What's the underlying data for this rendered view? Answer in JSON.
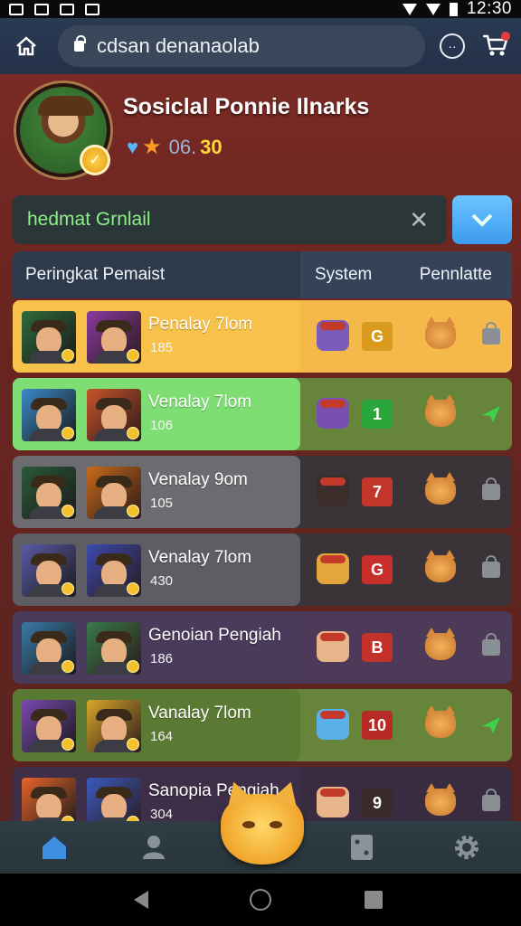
{
  "status_bar": {
    "time": "12:30"
  },
  "browser": {
    "url": "cdsan denanaolab"
  },
  "profile": {
    "name": "Sosiclal Ponnie Ilnarks",
    "stat_a": "06.",
    "stat_b": "30"
  },
  "search": {
    "value": "hedmat Grnlail"
  },
  "table": {
    "header_left": "Peringkat Pemaist",
    "header_col1": "System",
    "header_col2": "Pennlatte",
    "rows": [
      {
        "name": "Penalay 7lom",
        "score": "185",
        "rank": "G",
        "state": "lock",
        "row_bg": "#f5b84a",
        "left_bg": "#f8c24a",
        "rank_bg": "#d99a1e",
        "sys_color": "#7a5cba"
      },
      {
        "name": "Venalay 7lom",
        "score": "106",
        "rank": "1",
        "state": "check",
        "row_bg": "#66853b",
        "left_bg": "#7ede74",
        "rank_bg": "#2aa63a",
        "sys_color": "#7a4fb0"
      },
      {
        "name": "Venalay 9om",
        "score": "105",
        "rank": "7",
        "state": "lock",
        "row_bg": "#3a3438",
        "left_bg": "#6c6c70",
        "rank_bg": "#c4352b",
        "sys_color": "#3a2d2a"
      },
      {
        "name": "Venalay 7lom",
        "score": "430",
        "rank": "G",
        "state": "lock",
        "row_bg": "#3a3438",
        "left_bg": "#5f5d64",
        "rank_bg": "#c82e2a",
        "sys_color": "#e2a63a"
      },
      {
        "name": "Genoian Pengiah",
        "score": "186",
        "rank": "B",
        "state": "lock",
        "row_bg": "#4c3a58",
        "left_bg": "#4a3a5c",
        "rank_bg": "#c4302a",
        "sys_color": "#e8b48a"
      },
      {
        "name": "Vanalay 7lom",
        "score": "164",
        "rank": "10",
        "state": "check",
        "row_bg": "#66853b",
        "left_bg": "#5a7a34",
        "rank_bg": "#b82a26",
        "sys_color": "#5ab0e8"
      },
      {
        "name": "Sanopia Pengiah",
        "score": "304",
        "rank": "9",
        "state": "lock",
        "row_bg": "#3a2c40",
        "left_bg": "#3e2e48",
        "rank_bg": "#3a2a2a",
        "sys_color": "#e8b48a"
      }
    ]
  },
  "icons": {
    "home": "home-icon",
    "user": "user-icon",
    "card": "card-icon",
    "settings": "gear-icon",
    "gem": "gem-icon",
    "star": "star-icon",
    "cart": "cart-icon"
  }
}
